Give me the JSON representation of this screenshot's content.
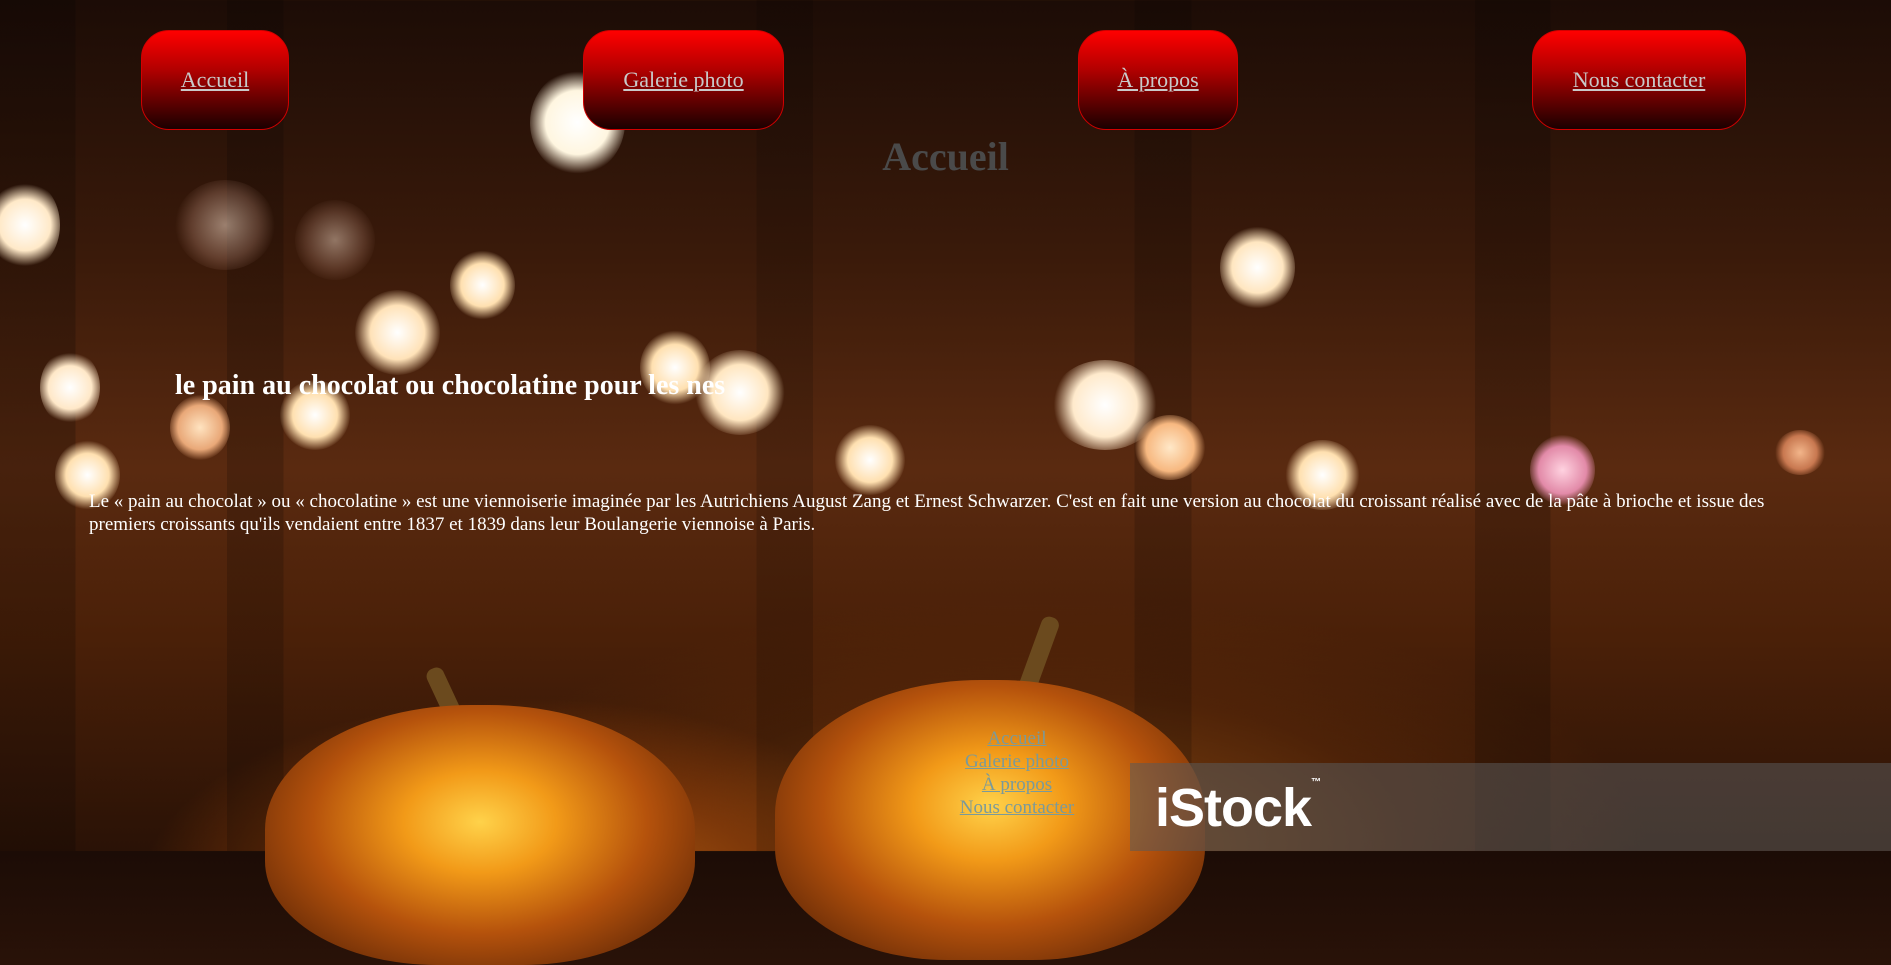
{
  "nav": {
    "home": "Accueil",
    "gallery": "Galerie photo",
    "about": "À propos",
    "contact": "Nous contacter"
  },
  "page_title": "Accueil",
  "section": {
    "title": "le pain au chocolat ou chocolatine pour les nes",
    "body": "Le « pain au chocolat » ou « chocolatine » est une viennoiserie imaginée par les Autrichiens August Zang et Ernest Schwarzer. C'est en fait une version au chocolat du croissant réalisé avec de la pâte à brioche et issue des premiers croissants qu'ils vendaient entre 1837 et 1839 dans leur Boulangerie viennoise à Paris."
  },
  "footer_nav": {
    "home": "Accueil",
    "gallery": "Galerie photo",
    "about": "À propos",
    "contact": "Nous contacter"
  },
  "watermark": {
    "text": "iStock",
    "mark": "™"
  },
  "colors": {
    "button_red": "#ff0000",
    "title_gray": "#4a4a4a",
    "link_gray": "#c9c9c9"
  }
}
